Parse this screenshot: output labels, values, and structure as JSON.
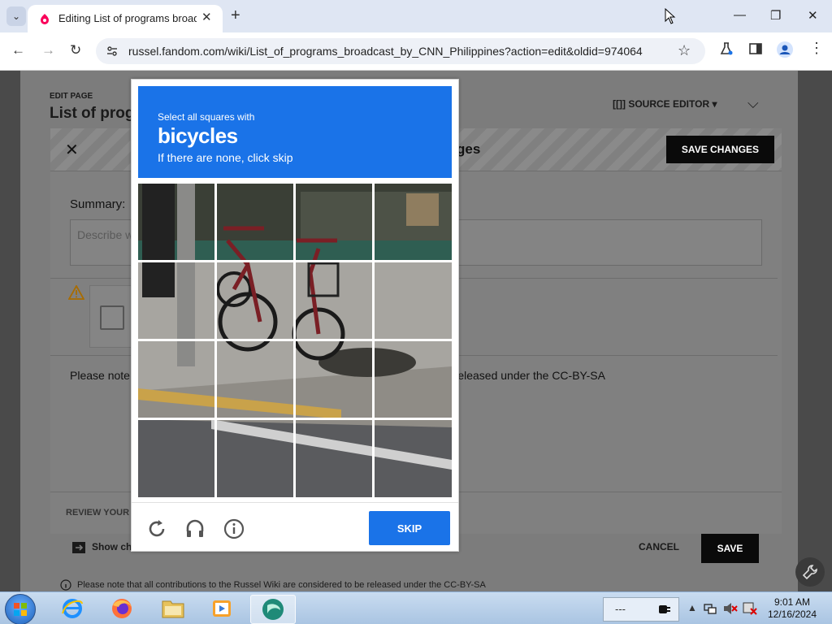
{
  "browser": {
    "tab_title": "Editing List of programs broad",
    "tab_menu": "⌄",
    "tab_close": "✕",
    "new_tab": "+",
    "url": "russel.fandom.com/wiki/List_of_programs_broadcast_by_CNN_Philippines?action=edit&oldid=974064",
    "back": "←",
    "forward": "→",
    "reload": "↻",
    "star": "☆",
    "minimize": "—",
    "maximize": "❐",
    "close": "✕",
    "more": "⋮"
  },
  "editor": {
    "edit_label": "EDIT PAGE",
    "page_title": "List of prog",
    "source_editor": "[[]] SOURCE EDITOR ▾",
    "collapse": "⌵",
    "dialog_close": "✕",
    "dialog_title": "ges",
    "save_changes": "SAVE CHANGES",
    "summary_label": "Summary:",
    "summary_placeholder": "Describe w",
    "notice": "Please note",
    "notice_tail": "e released under the CC-BY-SA",
    "review_label": "REVIEW YOUR",
    "show_changes": "Show ch",
    "cancel": "CANCEL",
    "save": "SAVE",
    "footer_note": "Please note that all contributions to the Russel Wiki are considered to be released under the CC-BY-SA"
  },
  "captcha": {
    "instruction_pre": "Select all squares with",
    "target": "bicycles",
    "instruction_sub": "If there are none, click skip",
    "skip": "SKIP",
    "header_color": "#1a73e8",
    "grid_rows": 4,
    "grid_cols": 4
  },
  "taskbar": {
    "tray_text": "---",
    "time": "9:01 AM",
    "date": "12/16/2024"
  }
}
